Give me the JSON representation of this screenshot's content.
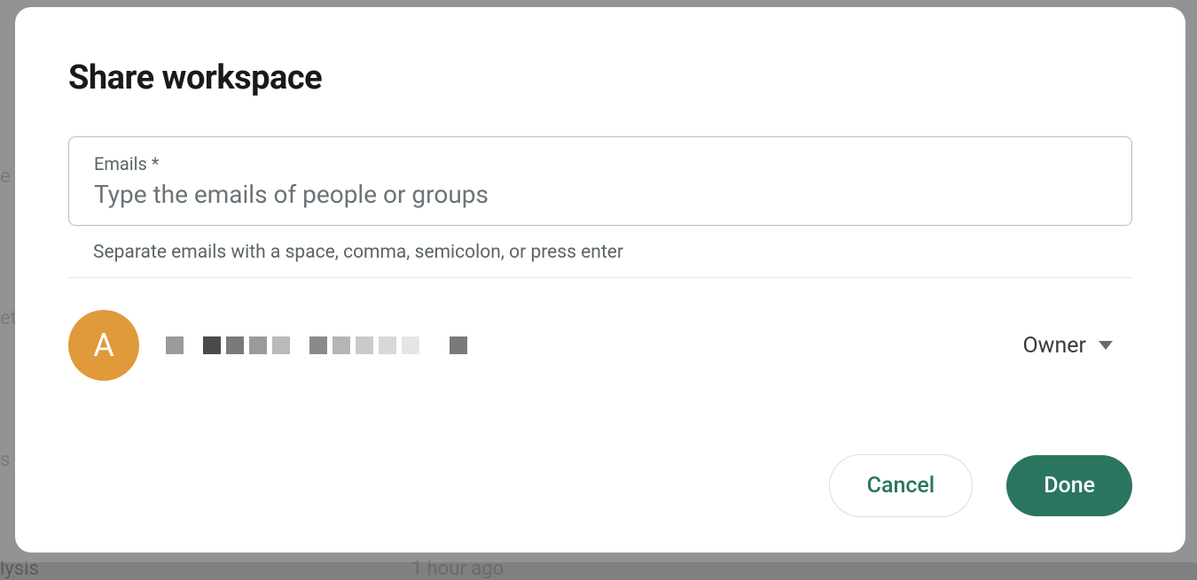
{
  "modal": {
    "title": "Share workspace",
    "email_field": {
      "label": "Emails *",
      "placeholder": "Type the emails of people or groups",
      "helper": "Separate emails with a space, comma, semicolon, or press enter"
    },
    "member": {
      "avatar_initial": "A",
      "role": "Owner"
    },
    "buttons": {
      "cancel": "Cancel",
      "done": "Done"
    }
  },
  "background": {
    "partial_text_1": "e",
    "partial_text_2": "et",
    "partial_text_3": "s",
    "bottom_left": "lysis",
    "bottom_time": "1 hour ago"
  }
}
